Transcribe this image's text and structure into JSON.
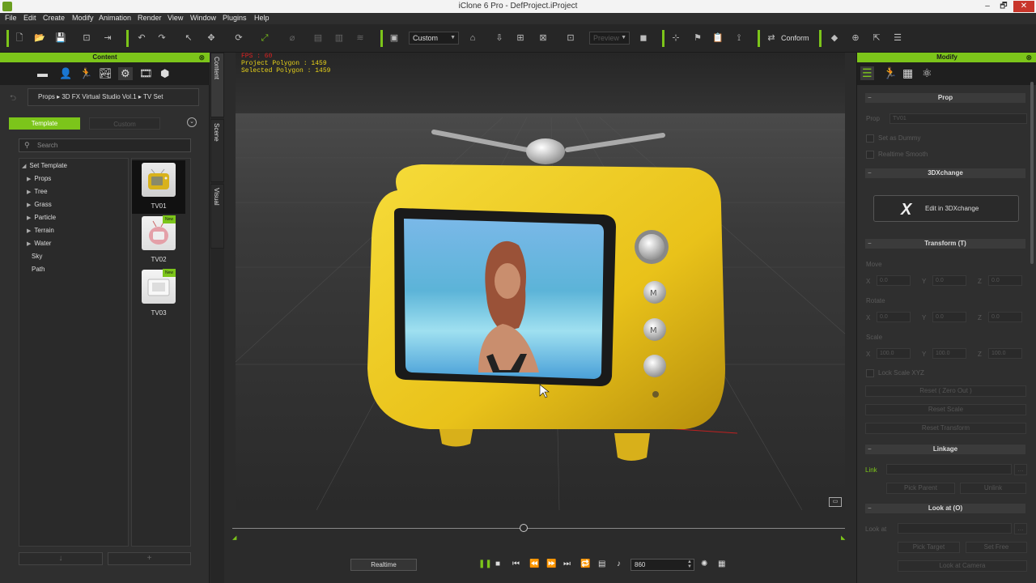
{
  "window": {
    "title": "iClone 6 Pro - DefProject.iProject",
    "minimize": "–",
    "restore": "🗗",
    "close": "✕"
  },
  "menu": [
    "File",
    "Edit",
    "Create",
    "Modify",
    "Animation",
    "Render",
    "View",
    "Window",
    "Plugins",
    "Help"
  ],
  "toolbar": {
    "camera_select": "Custom",
    "preview_select": "Preview",
    "conform_label": "Conform"
  },
  "content_panel": {
    "title": "Content",
    "breadcrumb": "Props ▸ 3D FX Virtual Studio Vol.1 ▸ TV Set",
    "tabs": [
      "Template",
      "Custom"
    ],
    "search_placeholder": "Search",
    "tree": [
      {
        "label": "Set Template",
        "expanded": true,
        "level": 0
      },
      {
        "label": "Props",
        "expanded": false,
        "level": 1
      },
      {
        "label": "Tree",
        "expanded": false,
        "level": 1
      },
      {
        "label": "Grass",
        "expanded": false,
        "level": 1
      },
      {
        "label": "Particle",
        "expanded": false,
        "level": 1
      },
      {
        "label": "Terrain",
        "expanded": false,
        "level": 1
      },
      {
        "label": "Water",
        "expanded": false,
        "level": 1
      },
      {
        "label": "Sky",
        "expanded": null,
        "level": 1
      },
      {
        "label": "Path",
        "expanded": null,
        "level": 1
      }
    ],
    "thumbnails": [
      {
        "label": "TV01",
        "badge": "",
        "selected": true
      },
      {
        "label": "TV02",
        "badge": "New",
        "selected": false
      },
      {
        "label": "TV03",
        "badge": "New",
        "selected": false
      }
    ],
    "bottom_buttons": [
      "↓",
      "+"
    ]
  },
  "side_tabs": [
    "Content",
    "Scene",
    "Visual"
  ],
  "viewport": {
    "fps": "FPS : 60",
    "project_polygon": "Project Polygon : 1459",
    "selected_polygon": "Selected Polygon : 1459"
  },
  "timeline": {
    "position": 0.475,
    "realtime_label": "Realtime",
    "frame": "860"
  },
  "modify_panel": {
    "title": "Modify",
    "prop_section": "Prop",
    "prop_label": "Prop",
    "prop_name": "TV01",
    "set_as_dummy": "Set as Dummy",
    "realtime_smooth": "Realtime Smooth",
    "xchange_section": "3DXchange",
    "edit_3dx": "Edit in 3DXchange",
    "transform_section": "Transform  (T)",
    "move_label": "Move",
    "rotate_label": "Rotate",
    "scale_label": "Scale",
    "axis_x": "X",
    "axis_y": "Y",
    "axis_z": "Z",
    "move": [
      "0.0",
      "0.0",
      "0.0"
    ],
    "rotate": [
      "0.0",
      "0.0",
      "0.0"
    ],
    "scale": [
      "100.0",
      "100.0",
      "100.0"
    ],
    "lock_scale": "Lock Scale XYZ",
    "reset_zero": "Reset ( Zero Out )",
    "reset_scale": "Reset Scale",
    "reset_transform": "Reset Transform",
    "linkage_section": "Linkage",
    "link_label": "Link",
    "pick_parent": "Pick Parent",
    "unlink": "Unlink",
    "lookat_section": "Look at  (O)",
    "look_at_label": "Look at",
    "pick_target": "Pick Target",
    "set_free": "Set Free",
    "look_at_camera": "Look at Camera"
  }
}
